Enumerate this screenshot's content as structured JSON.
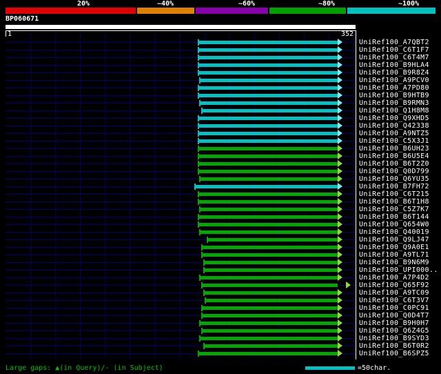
{
  "identity_key": {
    "labels": [
      "20%",
      "~40%",
      "~60%",
      "~80%",
      "~100%"
    ],
    "segments": [
      {
        "bin": "20%",
        "color": "#e00000"
      },
      {
        "bin": "~40%",
        "color": "#e08000"
      },
      {
        "bin": "~60%",
        "color": "#8800aa"
      },
      {
        "bin": "~80%",
        "color": "#00a000"
      },
      {
        "bin": "~100%",
        "color": "#00c0c0"
      }
    ]
  },
  "query": {
    "name": "BP060671",
    "start_label": "1",
    "end_label": "352"
  },
  "chart_data": {
    "type": "bar",
    "subtype": "blast-alignment-overview",
    "orientation": "horizontal",
    "title": "BP060671",
    "query_length": 352,
    "axis": {
      "min": 1,
      "max": 352,
      "grid_interval": 25
    },
    "identity_legend": {
      "cyan": "~100%",
      "green": "~80%"
    },
    "colors": {
      "cyan": "#00c2c2",
      "green": "#00a800",
      "cyan_light": "#80eaea",
      "green_light": "#90d840"
    },
    "hits": [
      {
        "label": "UniRef100_A7QBT2",
        "color": "cyan",
        "q_start": 193,
        "q_end": 334
      },
      {
        "label": "UniRef100_C6T1F7",
        "color": "cyan",
        "q_start": 193,
        "q_end": 334
      },
      {
        "label": "UniRef100_C6T4M7",
        "color": "cyan",
        "q_start": 193,
        "q_end": 334
      },
      {
        "label": "UniRef100_B9HLA4",
        "color": "cyan",
        "q_start": 193,
        "q_end": 334
      },
      {
        "label": "UniRef100_B9R8Z4",
        "color": "cyan",
        "q_start": 193,
        "q_end": 334
      },
      {
        "label": "UniRef100_A9PCV0",
        "color": "cyan",
        "q_start": 195,
        "q_end": 334
      },
      {
        "label": "UniRef100_A7PD80",
        "color": "cyan",
        "q_start": 193,
        "q_end": 334
      },
      {
        "label": "UniRef100_B9HTB9",
        "color": "cyan",
        "q_start": 193,
        "q_end": 334
      },
      {
        "label": "UniRef100_B9RMN3",
        "color": "cyan",
        "q_start": 195,
        "q_end": 334
      },
      {
        "label": "UniRef100_Q1H8M8",
        "color": "cyan",
        "q_start": 197,
        "q_end": 334
      },
      {
        "label": "UniRef100_Q9XHD5",
        "color": "cyan",
        "q_start": 193,
        "q_end": 334
      },
      {
        "label": "UniRef100_Q42338",
        "color": "cyan",
        "q_start": 193,
        "q_end": 334
      },
      {
        "label": "UniRef100_A9NTZ5",
        "color": "cyan",
        "q_start": 193,
        "q_end": 334
      },
      {
        "label": "UniRef100_C5X3J1",
        "color": "cyan",
        "q_start": 193,
        "q_end": 334
      },
      {
        "label": "UniRef100_B6UH23",
        "color": "green",
        "q_start": 193,
        "q_end": 334
      },
      {
        "label": "UniRef100_B6U5E4",
        "color": "green",
        "q_start": 193,
        "q_end": 334
      },
      {
        "label": "UniRef100_B6T2Z0",
        "color": "green",
        "q_start": 193,
        "q_end": 334
      },
      {
        "label": "UniRef100_Q0D799",
        "color": "green",
        "q_start": 193,
        "q_end": 334
      },
      {
        "label": "UniRef100_Q6YU35",
        "color": "green",
        "q_start": 195,
        "q_end": 334
      },
      {
        "label": "UniRef100_B7FH72",
        "color": "cyan",
        "q_start": 190,
        "q_end": 334
      },
      {
        "label": "UniRef100_C6T215",
        "color": "green",
        "q_start": 193,
        "q_end": 334
      },
      {
        "label": "UniRef100_B6T1H8",
        "color": "green",
        "q_start": 193,
        "q_end": 334
      },
      {
        "label": "UniRef100_C5Z7K7",
        "color": "green",
        "q_start": 195,
        "q_end": 334
      },
      {
        "label": "UniRef100_B6T144",
        "color": "green",
        "q_start": 193,
        "q_end": 334
      },
      {
        "label": "UniRef100_Q654W0",
        "color": "green",
        "q_start": 193,
        "q_end": 334
      },
      {
        "label": "UniRef100_Q40019",
        "color": "green",
        "q_start": 195,
        "q_end": 334
      },
      {
        "label": "UniRef100_Q9LJ47",
        "color": "green",
        "q_start": 202,
        "q_end": 334
      },
      {
        "label": "UniRef100_Q9A0E1",
        "color": "green",
        "q_start": 197,
        "q_end": 334
      },
      {
        "label": "UniRef100_A9TL71",
        "color": "green",
        "q_start": 197,
        "q_end": 334
      },
      {
        "label": "UniRef100_B9N6M9",
        "color": "green",
        "q_start": 199,
        "q_end": 334
      },
      {
        "label": "UniRef100_UPI000..",
        "color": "green",
        "q_start": 199,
        "q_end": 334
      },
      {
        "label": "UniRef100_A7P4D2",
        "color": "green",
        "q_start": 195,
        "q_end": 334
      },
      {
        "label": "UniRef100_Q65F92",
        "color": "green",
        "q_start": 197,
        "q_end": 334,
        "arrow_detached": true
      },
      {
        "label": "UniRef100_A9TC09",
        "color": "green",
        "q_start": 199,
        "q_end": 334
      },
      {
        "label": "UniRef100_C6T3V7",
        "color": "green",
        "q_start": 200,
        "q_end": 334
      },
      {
        "label": "UniRef100_C0PC91",
        "color": "green",
        "q_start": 197,
        "q_end": 334
      },
      {
        "label": "UniRef100_Q0D4T7",
        "color": "green",
        "q_start": 197,
        "q_end": 334
      },
      {
        "label": "UniRef100_B9H0H7",
        "color": "green",
        "q_start": 195,
        "q_end": 334
      },
      {
        "label": "UniRef100_Q6Z4G5",
        "color": "green",
        "q_start": 197,
        "q_end": 334
      },
      {
        "label": "UniRef100_B9SYD3",
        "color": "green",
        "q_start": 195,
        "q_end": 334
      },
      {
        "label": "UniRef100_B6T0R2",
        "color": "green",
        "q_start": 199,
        "q_end": 334
      },
      {
        "label": "UniRef100_B6SPZ5",
        "color": "green",
        "q_start": 193,
        "q_end": 334
      }
    ]
  },
  "footer": {
    "gaps_note": "Large gaps: ▲(in Query)/- (in Subject)",
    "scale_label": "=50char.",
    "scale_chars": 50
  }
}
